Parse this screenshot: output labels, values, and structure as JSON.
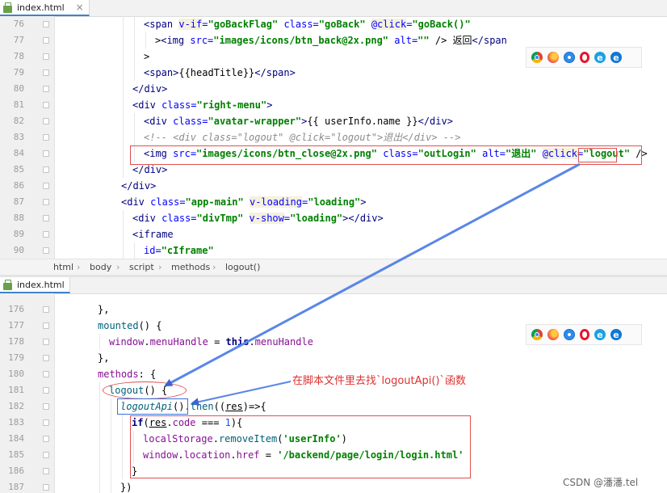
{
  "panes": [
    {
      "tab": {
        "label": "index.html",
        "close": "×"
      },
      "lines": [
        {
          "n": "76",
          "indent": 2,
          "html": "<span class=\"t\">&lt;span</span> <span class=\"at vd\">v-if</span><span class=\"at\">=</span><span class=\"s\">\"goBackFlag\"</span> <span class=\"at\">class=</span><span class=\"s\">\"goBack\"</span> <span class=\"at vd\">@click</span><span class=\"at\">=</span><span class=\"s\">\"goBack()\"</span>"
        },
        {
          "n": "77",
          "indent": 3,
          "html": "&gt;<span class=\"t\">&lt;img</span> <span class=\"at\">src=</span><span class=\"s\">\"images/icons/btn_back@2x.png\"</span> <span class=\"at\">alt=</span><span class=\"s\">\"\"</span> /&gt; 返回<span class=\"t\">&lt;/span</span>"
        },
        {
          "n": "78",
          "indent": 2,
          "html": "&gt;"
        },
        {
          "n": "79",
          "indent": 2,
          "html": "<span class=\"t\">&lt;span&gt;</span>{{headTitle}}<span class=\"t\">&lt;/span&gt;</span>"
        },
        {
          "n": "80",
          "indent": 1,
          "html": "<span class=\"t\">&lt;/div&gt;</span>"
        },
        {
          "n": "81",
          "indent": 1,
          "html": "<span class=\"t\">&lt;div</span> <span class=\"at\">class=</span><span class=\"s\">\"right-menu\"</span><span class=\"t\">&gt;</span>"
        },
        {
          "n": "82",
          "indent": 2,
          "html": "<span class=\"t\">&lt;div</span> <span class=\"at\">class=</span><span class=\"s\">\"avatar-wrapper\"</span><span class=\"t\">&gt;</span>{{ userInfo.name }}<span class=\"t\">&lt;/div&gt;</span>"
        },
        {
          "n": "83",
          "indent": 2,
          "html": "<span class=\"cm\">&lt;!-- &lt;div class=\"logout\" @click=\"logout\"&gt;退出&lt;/div&gt; --&gt;</span>"
        },
        {
          "n": "84",
          "indent": 2,
          "html": "<span class=\"t\">&lt;img</span> <span class=\"at\">src=</span><span class=\"s\">\"images/icons/btn_close@2x.png\"</span> <span class=\"at\">class=</span><span class=\"s\">\"outLogin\"</span> <span class=\"at\">alt=</span><span class=\"s\">\"退出\"</span> <span class=\"at vd\">@click</span><span class=\"at\">=</span><span class=\"s\">\"logout\"</span> /&gt;"
        },
        {
          "n": "85",
          "indent": 1,
          "html": "<span class=\"t\">&lt;/div&gt;</span>"
        },
        {
          "n": "86",
          "indent": 0,
          "html": "<span class=\"t\">&lt;/div&gt;</span>"
        },
        {
          "n": "87",
          "indent": 0,
          "html": "<span class=\"t\">&lt;div</span> <span class=\"at\">class=</span><span class=\"s\">\"app-main\"</span> <span class=\"at vd\">v-loading</span><span class=\"at\">=</span><span class=\"s\">\"loading\"</span><span class=\"t\">&gt;</span>"
        },
        {
          "n": "88",
          "indent": 1,
          "html": "<span class=\"t\">&lt;div</span> <span class=\"at\">class=</span><span class=\"s\">\"divTmp\"</span> <span class=\"at vd\">v-show</span><span class=\"at\">=</span><span class=\"s\">\"loading\"</span><span class=\"t\">&gt;&lt;/div&gt;</span>"
        },
        {
          "n": "89",
          "indent": 1,
          "html": "<span class=\"t\">&lt;iframe</span>"
        },
        {
          "n": "90",
          "indent": 2,
          "html": "<span class=\"at\">id=</span><span class=\"s\">\"cIframe\"</span>"
        }
      ],
      "breadcrumb": [
        "html",
        "body",
        "script",
        "methods",
        "logout()"
      ]
    },
    {
      "tab": {
        "label": "index.html",
        "close": ""
      },
      "lines": [
        {
          "n": "176",
          "indent": 0,
          "html": "},"
        },
        {
          "n": "177",
          "indent": 0,
          "html": "<span class=\"fn\">mounted</span>() {"
        },
        {
          "n": "178",
          "indent": 1,
          "html": "<span class=\"pp\">window</span>.<span class=\"pp\">menuHandle</span> = <span class=\"k\">this</span>.<span class=\"pp\">menuHandle</span>"
        },
        {
          "n": "179",
          "indent": 0,
          "html": "},"
        },
        {
          "n": "180",
          "indent": 0,
          "html": "<span class=\"pp\">methods</span>: {"
        },
        {
          "n": "181",
          "indent": 1,
          "html": "<span class=\"fn\">logout</span>() {"
        },
        {
          "n": "182",
          "indent": 2,
          "html": "<span class=\"fi\">logoutApi</span>().<span class=\"fn\">then</span>((<span class=\"ul\">res</span>)=&gt;{"
        },
        {
          "n": "183",
          "indent": 3,
          "html": "<span class=\"k\">if</span>(<span class=\"ul\">res</span>.<span class=\"pp\">code</span> === <span class=\"num\">1</span>){"
        },
        {
          "n": "184",
          "indent": 4,
          "html": "<span class=\"pp\">localStorage</span>.<span class=\"fn\">removeItem</span>(<span class=\"s\">'userInfo'</span>)"
        },
        {
          "n": "185",
          "indent": 4,
          "html": "<span class=\"pp\">window</span>.<span class=\"pp\">location</span>.<span class=\"pp\">href</span> = <span class=\"s\">'/backend/page/login/login.html'</span>"
        },
        {
          "n": "186",
          "indent": 3,
          "html": "}"
        },
        {
          "n": "187",
          "indent": 2,
          "html": "})"
        }
      ]
    }
  ],
  "annotations": {
    "note": "在脚本文件里去找`logoutApi()`函数"
  },
  "browser_icons": [
    "chrome-icon",
    "firefox-icon",
    "safari-icon",
    "opera-icon",
    "ie-icon",
    "edge-icon"
  ],
  "watermark": "CSDN @潘潘.tel"
}
